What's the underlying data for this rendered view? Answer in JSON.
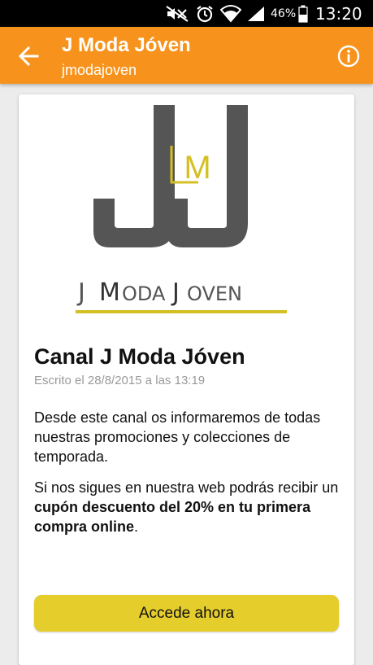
{
  "status_bar": {
    "battery_percent": "46%",
    "time": "13:20",
    "icons": [
      "mute-icon",
      "alarm-icon",
      "wifi-icon",
      "signal-icon",
      "battery-icon"
    ]
  },
  "app_bar": {
    "title": "J Moda Jóven",
    "subtitle": "jmodajoven",
    "back_icon": "arrow-back-icon",
    "info_icon": "info-icon",
    "background_color": "#f7931d"
  },
  "post": {
    "logo": {
      "main_letters": "J J",
      "center_letter": "M",
      "wordmark": "J MODAJOVEN",
      "gray_color": "#555555",
      "gold_color": "#d4c024"
    },
    "title": "Canal J Moda Jóven",
    "date": "Escrito el 28/8/2015 a las 13:19",
    "paragraph_1": "Desde este canal os informaremos de todas nuestras promociones y colecciones de temporada.",
    "paragraph_2_prefix": "Si nos sigues en nuestra web podrás recibir un ",
    "paragraph_2_bold": "cupón descuento del 20% en tu primera compra online",
    "paragraph_2_suffix": ".",
    "cta_label": "Accede ahora",
    "cta_color": "#e5cd2c"
  }
}
